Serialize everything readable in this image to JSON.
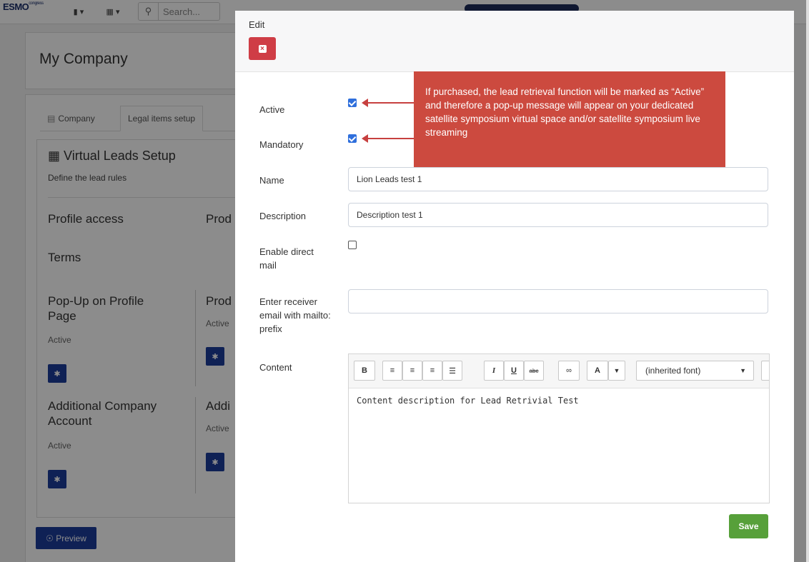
{
  "background": {
    "logo": "ESMO",
    "logo_sup": "congress",
    "search_placeholder": "Search...",
    "page_title": "My Company",
    "tabs": [
      {
        "label": "Company",
        "icon": "chart-icon"
      },
      {
        "label": "Legal items setup"
      }
    ],
    "section_title": "Virtual Leads Setup",
    "section_icon": "grid-icon",
    "section_subtitle": "Define the lead rules",
    "profile_access": "Profile access",
    "prod_1": "Prod",
    "terms": "Terms",
    "popup_profile": "Pop-Up on Profile Page",
    "active_1": "Active",
    "prod_2": "Prod",
    "active_2": "Active",
    "additional_account": "Additional Company Account",
    "active_3": "Active",
    "addi": "Addi",
    "active_4": "Active",
    "preview_label": "Preview"
  },
  "modal": {
    "title": "Edit",
    "fields": {
      "active_label": "Active",
      "active_checked": true,
      "mandatory_label": "Mandatory",
      "mandatory_checked": true,
      "name_label": "Name",
      "name_value": "Lion Leads test 1",
      "description_label": "Description",
      "description_value": "Description test 1",
      "direct_mail_label": "Enable direct mail",
      "direct_mail_checked": false,
      "receiver_label": "Enter receiver email with mailto: prefix",
      "receiver_value": "",
      "content_label": "Content"
    },
    "callout": "If purchased, the lead retrieval function will be marked as “Active” and therefore a pop-up message will appear on your dedicated satellite symposium virtual space and/or satellite symposium live streaming",
    "editor": {
      "toolbar": {
        "bold": "B",
        "align_left_icon": "align-left-icon",
        "align_center_icon": "align-center-icon",
        "align_right_icon": "align-right-icon",
        "align_justify_icon": "align-justify-icon",
        "italic": "I",
        "underline": "U",
        "strike": "abc",
        "link_icon": "link-icon",
        "font_color": "A",
        "font_family": "(inherited font)"
      },
      "content": "Content description for Lead Retrivial Test"
    },
    "save_label": "Save"
  },
  "colors": {
    "accent_red": "#cc4a3f",
    "primary_blue": "#1d3c9c",
    "save_green": "#57a03a",
    "close_red": "#cf3d46"
  }
}
